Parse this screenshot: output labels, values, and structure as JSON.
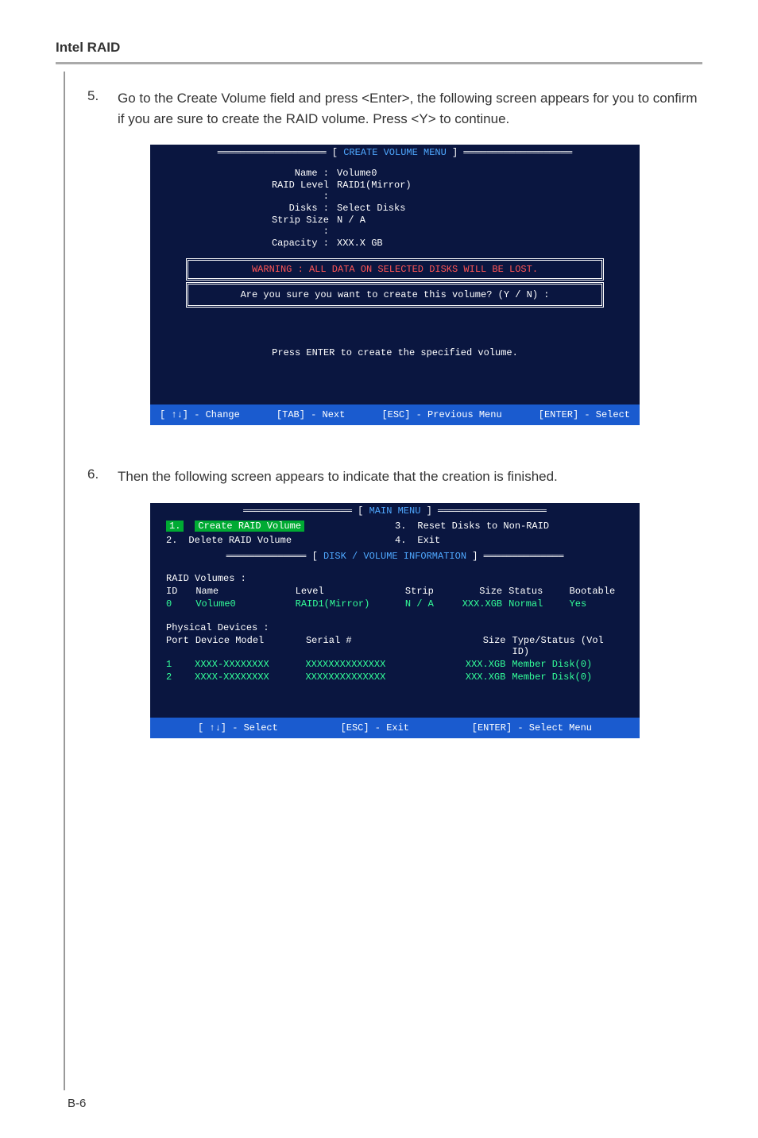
{
  "header": "Intel RAID",
  "step5": {
    "num": "5.",
    "text": "Go to the Create Volume field and press <Enter>, the following screen appears for you to confirm if you are sure to create the RAID volume. Press <Y> to continue."
  },
  "bios1": {
    "title": "CREATE VOLUME MENU",
    "fields": {
      "name_label": "Name :",
      "name_val": "Volume0",
      "raid_label": "RAID Level :",
      "raid_val": "RAID1(Mirror)",
      "disks_label": "Disks :",
      "disks_val": "Select Disks",
      "strip_label": "Strip Size :",
      "strip_val": "N / A",
      "cap_label": "Capacity :",
      "cap_val": "XXX.X  GB"
    },
    "warning": "WARNING : ALL DATA ON SELECTED DISKS WILL BE LOST.",
    "confirm": "Are  you  sure  you  want  to  create  this  volume?  (Y / N)  :",
    "help": "Press  ENTER  to  create  the  specified  volume.",
    "footer": {
      "change": "[ ↑↓] - Change",
      "next": "[TAB] - Next",
      "prev": "[ESC] - Previous Menu",
      "select": "[ENTER] - Select"
    }
  },
  "step6": {
    "num": "6.",
    "text": "Then the following screen appears to indicate that the creation is finished."
  },
  "bios2": {
    "title": "MAIN  MENU",
    "menu": {
      "m1_num": "1.",
      "m1_label": "Create  RAID  Volume",
      "m2_num": "2.",
      "m2_label": "Delete  RAID  Volume",
      "m3_num": "3.",
      "m3_label": "Reset Disks to Non-RAID",
      "m4_num": "4.",
      "m4_label": "Exit"
    },
    "section": "DISK / VOLUME INFORMATION",
    "raid_header": "RAID  Volumes :",
    "cols": {
      "id": "ID",
      "name": "Name",
      "level": "Level",
      "strip": "Strip",
      "size": "Size",
      "status": "Status",
      "boot": "Bootable"
    },
    "vol": {
      "id": "0",
      "name": "Volume0",
      "level": "RAID1(Mirror)",
      "strip": "N / A",
      "size": "XXX.XGB",
      "status": "Normal",
      "boot": "Yes"
    },
    "phys_header": "Physical  Devices :",
    "pcols": {
      "port": "Port",
      "model": "Device  Model",
      "serial": "Serial  #",
      "size": "Size",
      "type": "Type/Status (Vol  ID)"
    },
    "dev1": {
      "port": "1",
      "model": "XXXX-XXXXXXXX",
      "serial": "XXXXXXXXXXXXXX",
      "size": "XXX.XGB",
      "type": "Member  Disk(0)"
    },
    "dev2": {
      "port": "2",
      "model": "XXXX-XXXXXXXX",
      "serial": "XXXXXXXXXXXXXX",
      "size": "XXX.XGB",
      "type": "Member  Disk(0)"
    },
    "footer": {
      "select": "[ ↑↓] - Select",
      "exit": "[ESC] - Exit",
      "menu": "[ENTER] - Select Menu"
    }
  },
  "page_num": "B-6"
}
